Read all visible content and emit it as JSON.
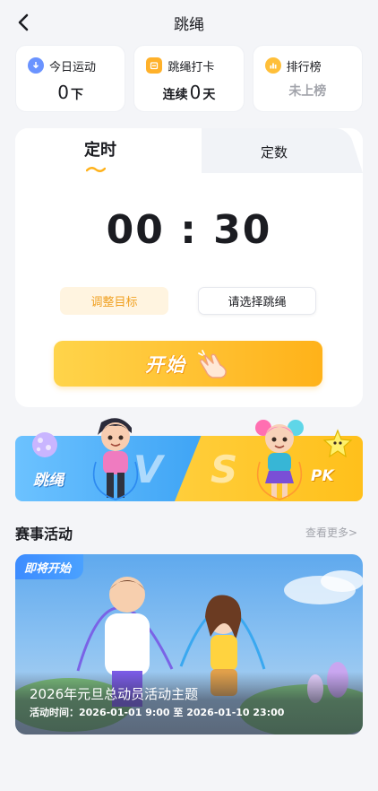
{
  "header": {
    "title": "跳绳",
    "back_icon": "chevron-left-icon"
  },
  "stats": [
    {
      "label": "今日运动",
      "value": "0",
      "unit": "下",
      "icon": "download-icon"
    },
    {
      "label": "跳绳打卡",
      "prefix": "连续",
      "value": "0",
      "unit": "天",
      "icon": "checkin-icon"
    },
    {
      "label": "排行榜",
      "value": "未上榜",
      "icon": "bar-chart-icon"
    }
  ],
  "timer": {
    "tabs": [
      "定时",
      "定数"
    ],
    "active_tab": "定时",
    "time": "00 : 30",
    "adjust_label": "调整目标",
    "select_label": "请选择跳绳",
    "start_label": "开始"
  },
  "vs_banner": {
    "left_label": "跳绳",
    "right_label": "PK"
  },
  "events": {
    "section_title": "赛事活动",
    "more_label": "查看更多>",
    "card": {
      "badge": "即将开始",
      "title": "2026年元旦总动员活动主题",
      "time": "活动时间：2026-01-01 9:00 至 2026-01-10 23:00"
    }
  },
  "colors": {
    "accent": "#ffc01b",
    "blue": "#3ea4f5",
    "text": "#1b1c21",
    "muted": "#a2a4ab"
  }
}
